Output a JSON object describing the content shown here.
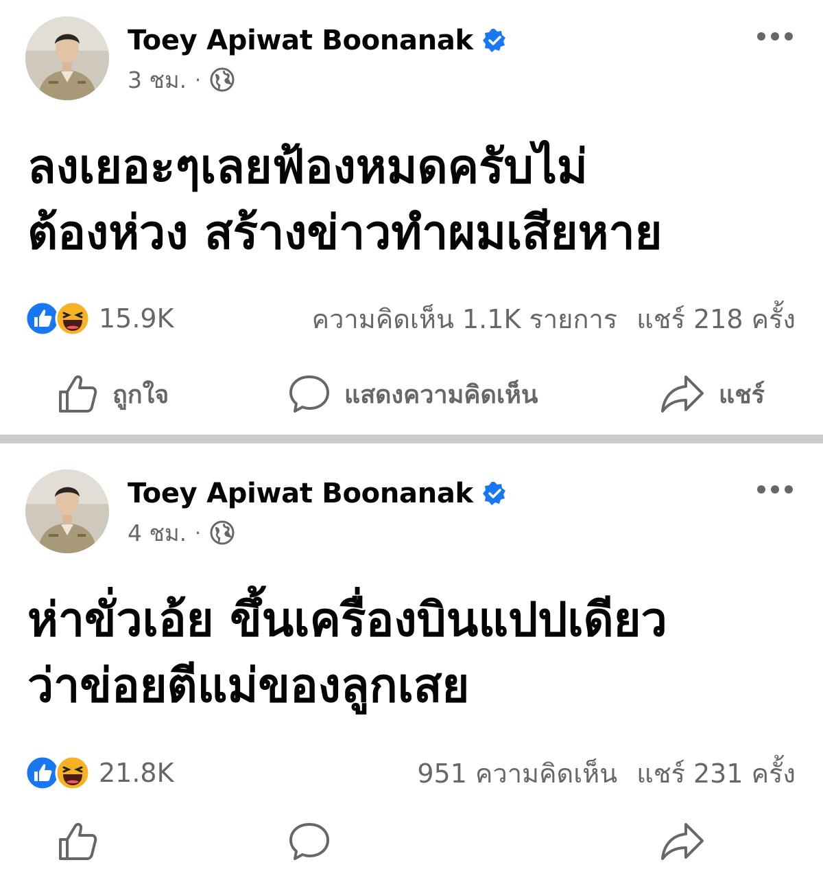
{
  "posts": [
    {
      "author": "Toey Apiwat Boonanak",
      "time": "3 ชม.",
      "separator": "·",
      "text_line1": "ลงเยอะๆเลยฟ้องหมดครับไม่",
      "text_line2": "ต้องห่วง สร้างข่าวทำผมเสียหาย",
      "reaction_count": "15.9K",
      "comments": "ความคิดเห็น 1.1K รายการ",
      "shares": "แชร์ 218 ครั้ง"
    },
    {
      "author": "Toey Apiwat Boonanak",
      "time": "4 ชม.",
      "separator": "·",
      "text_line1": "ห่าขั่วเอ้ย ขึ้นเครื่องบินแปปเดียว",
      "text_line2": "ว่าข่อยตีแม่ของลูกเสย",
      "reaction_count": "21.8K",
      "comments": "951 ความคิดเห็น",
      "shares": "แชร์ 231 ครั้ง"
    }
  ],
  "actions": {
    "like": "ถูกใจ",
    "comment": "แสดงความคิดเห็น",
    "share": "แชร์"
  },
  "icons": {
    "verified": "verified-badge-icon",
    "privacy": "globe-icon",
    "more": "more-options-icon",
    "like_reaction": "like-reaction-icon",
    "haha_reaction": "haha-reaction-icon"
  },
  "colors": {
    "facebook_blue": "#1877f2",
    "secondary_text": "#65676b",
    "divider": "#c9ccd1",
    "haha_yellow": "#f7b125"
  }
}
